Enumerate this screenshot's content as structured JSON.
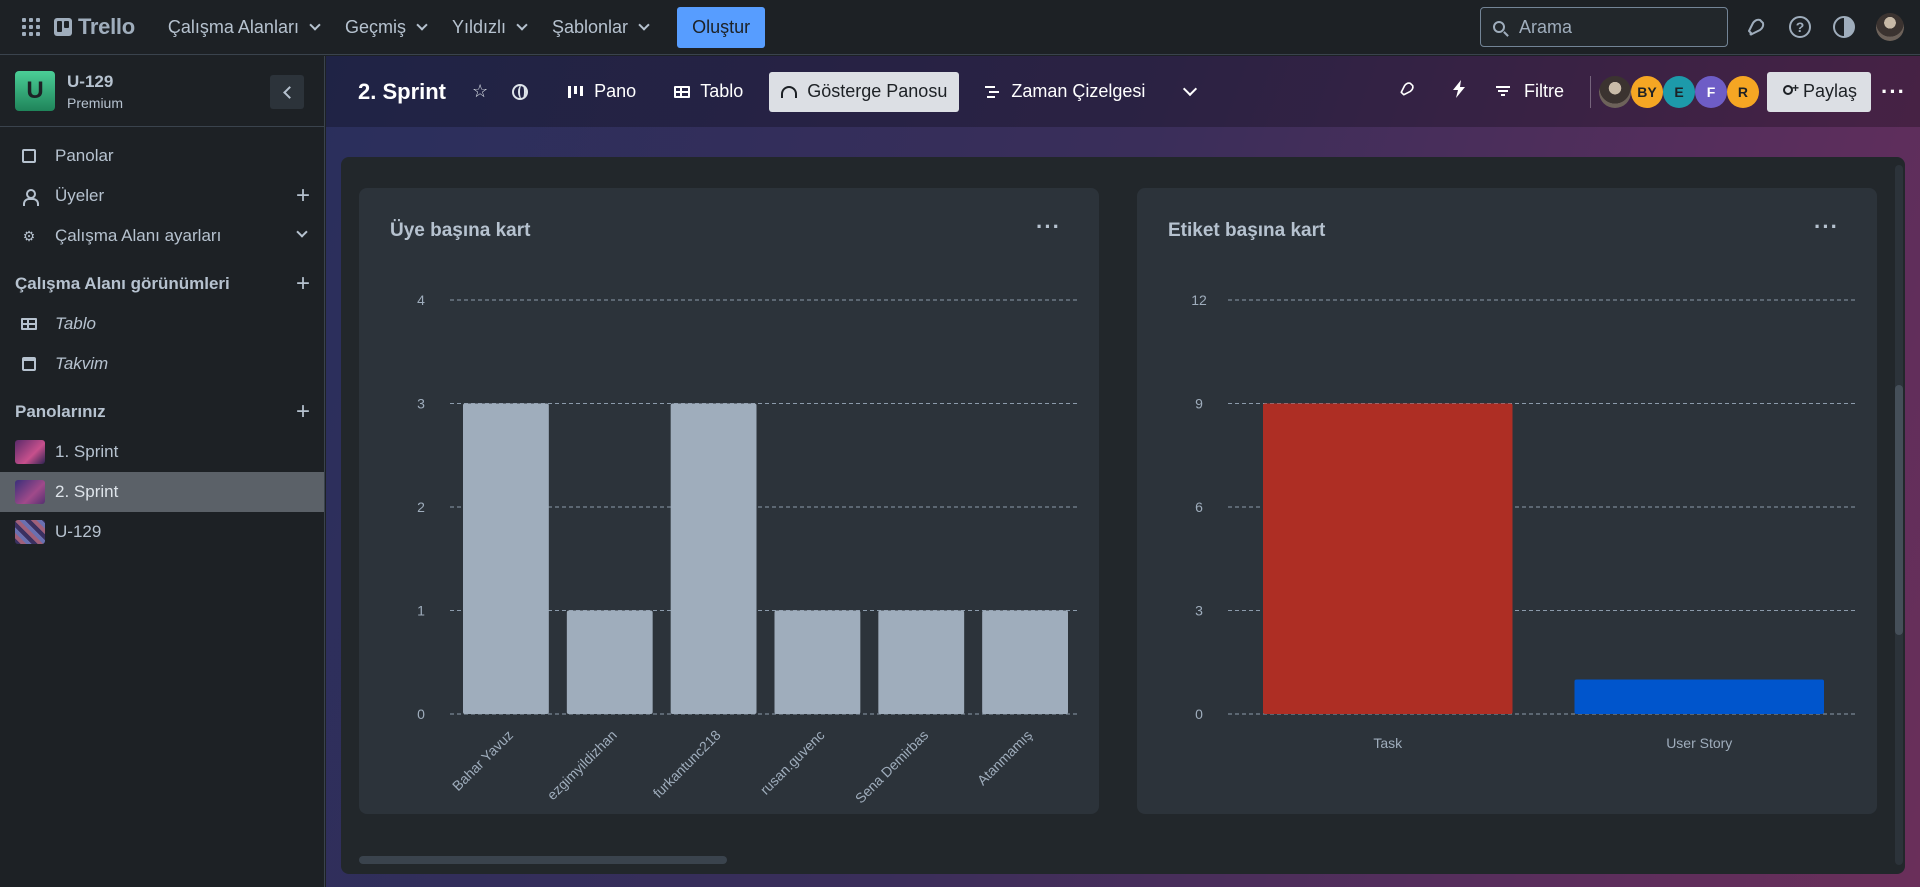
{
  "topbar": {
    "logo": "Trello",
    "nav": [
      "Çalışma Alanları",
      "Geçmiş",
      "Yıldızlı",
      "Şablonlar"
    ],
    "create": "Oluştur",
    "search_placeholder": "Arama"
  },
  "sidebar": {
    "workspace_initial": "U",
    "workspace_name": "U-129",
    "workspace_plan": "Premium",
    "items": [
      "Panolar",
      "Üyeler",
      "Çalışma Alanı ayarları"
    ],
    "views_section": "Çalışma Alanı görünümleri",
    "views": [
      "Tablo",
      "Takvim"
    ],
    "boards_section": "Panolarınız",
    "boards": [
      "1. Sprint",
      "2. Sprint",
      "U-129"
    ],
    "active_board": "2. Sprint"
  },
  "header": {
    "board_title": "2. Sprint",
    "tabs": [
      "Pano",
      "Tablo",
      "Gösterge Panosu",
      "Zaman Çizelgesi"
    ],
    "active_tab": "Gösterge Panosu",
    "filter": "Filtre",
    "share": "Paylaş",
    "members": [
      "BY",
      "E",
      "F",
      "R"
    ],
    "member_colors": [
      "#f5a623",
      "#1d9aaa",
      "#6e5dc6",
      "#f5a623"
    ]
  },
  "cards": {
    "members_card_title": "Üye başına kart",
    "labels_card_title": "Etiket başına kart"
  },
  "chart_data": [
    {
      "type": "bar",
      "title": "Üye başına kart",
      "categories": [
        "Bahar Yavuz",
        "ezgimyildizhan",
        "furkantunc218",
        "rusan.guvenc",
        "Sena Demirbas",
        "Atanmamış"
      ],
      "values": [
        3,
        1,
        3,
        1,
        1,
        1
      ],
      "colors": [
        "#9fadbc"
      ],
      "ylim": [
        0,
        4
      ],
      "yticks": [
        0,
        1,
        2,
        3,
        4
      ],
      "grid": true
    },
    {
      "type": "bar",
      "title": "Etiket başına kart",
      "categories": [
        "Task",
        "User Story"
      ],
      "values": [
        9,
        1
      ],
      "colors": [
        "#ae2e24",
        "#0055cc"
      ],
      "ylim": [
        0,
        12
      ],
      "yticks": [
        0,
        3,
        6,
        9,
        12
      ],
      "grid": true
    }
  ]
}
